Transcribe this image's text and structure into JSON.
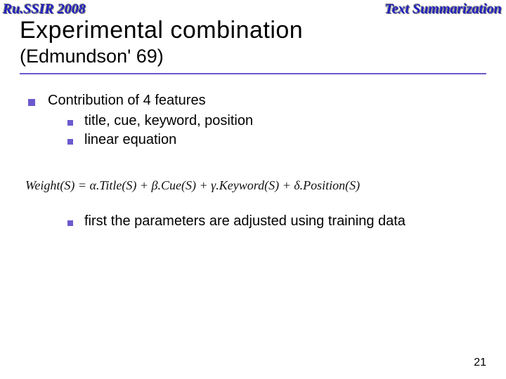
{
  "header": {
    "left": "Ru.SSIR 2008",
    "right": "Text Summarization"
  },
  "title": {
    "main": "Experimental combination",
    "sub": "(Edmundson' 69)"
  },
  "bullets": {
    "lvl1_a": "Contribution of 4 features",
    "lvl2_a": "title, cue, keyword, position",
    "lvl2_b": "linear equation",
    "lvl2_c": "first the parameters are adjusted using training data"
  },
  "formula": "Weight(S) = α.Title(S) + β.Cue(S) + γ.Keyword(S) + δ.Position(S)",
  "page_number": "21"
}
